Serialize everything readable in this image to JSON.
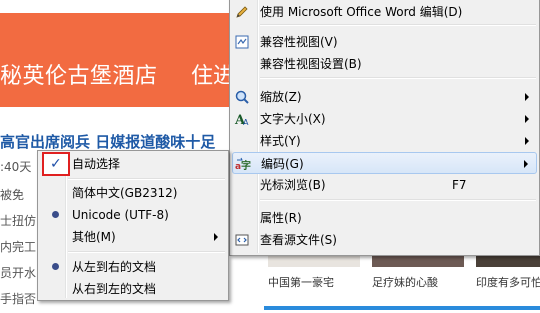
{
  "background": {
    "banner_text": "秘英伦古堡酒店",
    "banner_tail": "住进",
    "headline": "高官出席阅兵 日媒报道酸味十足",
    "fragments": [
      ":40天",
      "被免",
      "士扭仿",
      "内完工",
      "员开水",
      "手指否"
    ],
    "captions": [
      "中国第一豪宅",
      "足疗妹的心酸",
      "印度有多可怕"
    ]
  },
  "main_menu": {
    "items": [
      {
        "label": "使用 Microsoft Office Word 编辑(D)",
        "icon": "pencil-icon"
      },
      {
        "label": "兼容性视图(V)",
        "icon": "compat-view-icon"
      },
      {
        "label": "兼容性视图设置(B)"
      },
      {
        "label": "缩放(Z)",
        "icon": "zoom-icon"
      },
      {
        "label": "文字大小(X)",
        "icon": "text-size-icon"
      },
      {
        "label": "样式(Y)"
      },
      {
        "label": "编码(G)",
        "icon": "encoding-icon"
      },
      {
        "label": "光标浏览(B)",
        "shortcut": "F7"
      },
      {
        "label": "属性(R)"
      },
      {
        "label": "查看源文件(S)",
        "icon": "view-source-icon"
      }
    ]
  },
  "encoding_menu": {
    "items": [
      {
        "label": "自动选择",
        "checked": true
      },
      {
        "label": "简体中文(GB2312)"
      },
      {
        "label": "Unicode (UTF-8)",
        "selected": true
      },
      {
        "label": "其他(M)"
      },
      {
        "label": "从左到右的文档",
        "selected": true
      },
      {
        "label": "从右到左的文档"
      }
    ]
  },
  "colors": {
    "banner": "#f26b41",
    "highlight_box": "#e02020",
    "link_blue": "#1f5aa6"
  }
}
